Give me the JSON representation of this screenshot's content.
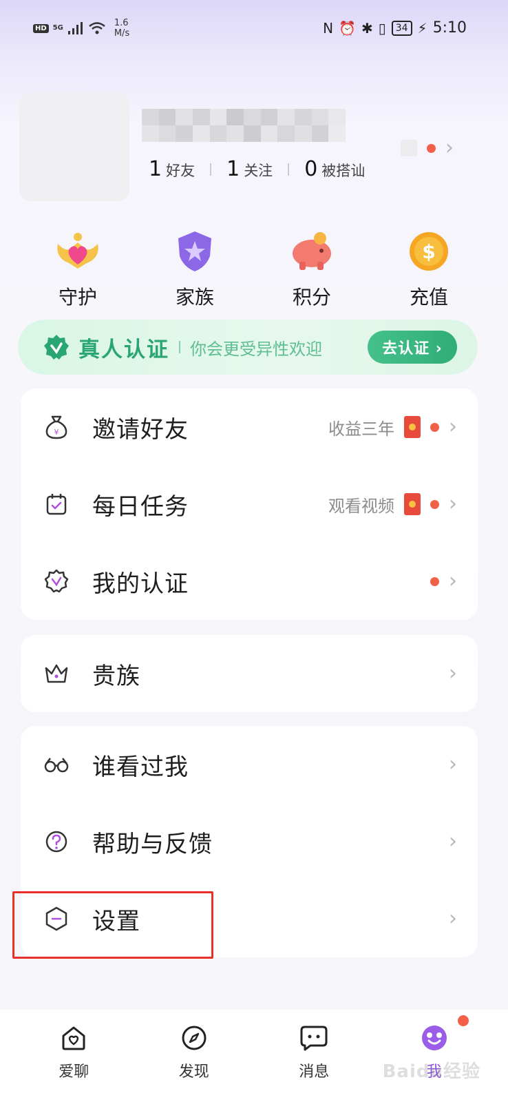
{
  "status_bar": {
    "hd": "HD",
    "signal": "5G",
    "speed_value": "1.6",
    "speed_unit": "M/s",
    "battery": "34",
    "time": "5:10"
  },
  "profile": {
    "stats": [
      {
        "num": "1",
        "label": "好友"
      },
      {
        "num": "1",
        "label": "关注"
      },
      {
        "num": "0",
        "label": "被搭讪"
      }
    ]
  },
  "quick_actions": [
    {
      "label": "守护",
      "icon": "heart-crown-icon"
    },
    {
      "label": "家族",
      "icon": "shield-star-icon"
    },
    {
      "label": "积分",
      "icon": "piggy-bank-icon"
    },
    {
      "label": "充值",
      "icon": "dollar-coin-icon"
    }
  ],
  "verify_banner": {
    "title": "真人认证",
    "subtitle": "你会更受异性欢迎",
    "button": "去认证 ›"
  },
  "menu_group_1": [
    {
      "label": "邀请好友",
      "hint": "收益三年",
      "icon": "money-bag-icon"
    },
    {
      "label": "每日任务",
      "hint": "观看视频",
      "icon": "calendar-check-icon"
    },
    {
      "label": "我的认证",
      "hint": "",
      "icon": "badge-check-icon"
    }
  ],
  "menu_group_2": [
    {
      "label": "贵族",
      "icon": "crown-icon"
    }
  ],
  "menu_group_3": [
    {
      "label": "谁看过我",
      "icon": "glasses-icon"
    },
    {
      "label": "帮助与反馈",
      "icon": "question-icon"
    },
    {
      "label": "设置",
      "icon": "settings-hexagon-icon"
    }
  ],
  "bottom_nav": [
    {
      "label": "爱聊",
      "icon": "home-heart-icon"
    },
    {
      "label": "发现",
      "icon": "compass-icon"
    },
    {
      "label": "消息",
      "icon": "chat-bubble-icon"
    },
    {
      "label": "我",
      "icon": "profile-icon"
    }
  ],
  "watermark": "Baidu经验",
  "colors": {
    "accent_green": "#2aa574",
    "active_purple": "#8b4fde",
    "dot_red": "#f2604a",
    "highlight_red": "#e8302a"
  }
}
